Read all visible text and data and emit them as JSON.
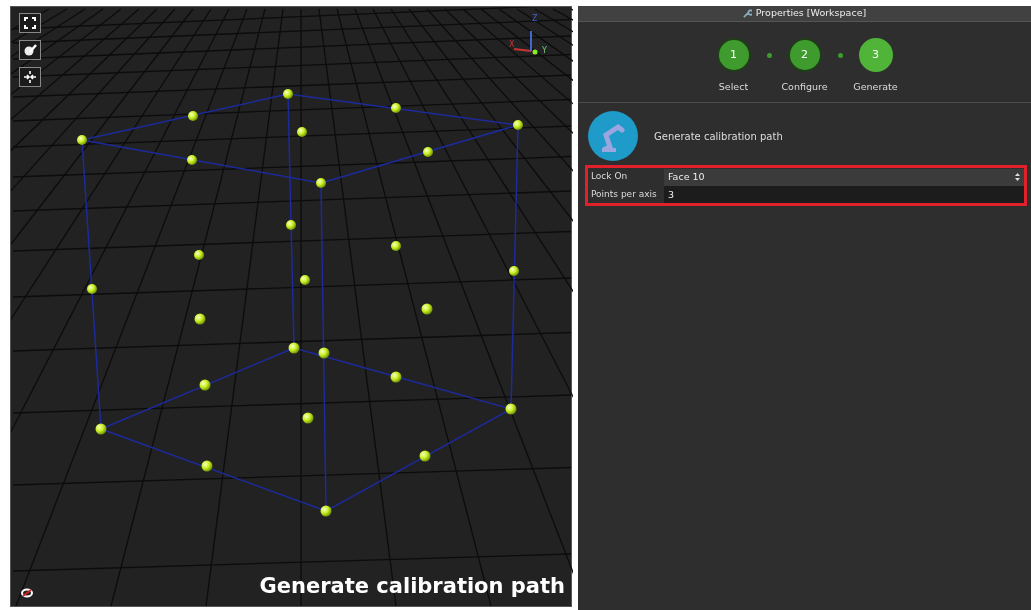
{
  "viewport": {
    "toolbar": [
      {
        "kind": "fullscreen"
      },
      {
        "kind": "paint"
      },
      {
        "kind": "collapse"
      }
    ],
    "axis_labels": [
      "X",
      "Y",
      "Z"
    ],
    "caption": "Generate calibration path"
  },
  "properties_panel": {
    "title": "Properties [Workspace]",
    "steps": [
      {
        "number": "1",
        "label": "Select",
        "selected": false
      },
      {
        "number": "2",
        "label": "Configure",
        "selected": false
      },
      {
        "number": "3",
        "label": "Generate",
        "selected": true
      }
    ],
    "heading": "Generate calibration path",
    "fields": [
      {
        "kind": "select",
        "label": "Lock On",
        "value": "Face 10"
      },
      {
        "kind": "input",
        "label": "Points per axis",
        "value": "3"
      }
    ]
  }
}
